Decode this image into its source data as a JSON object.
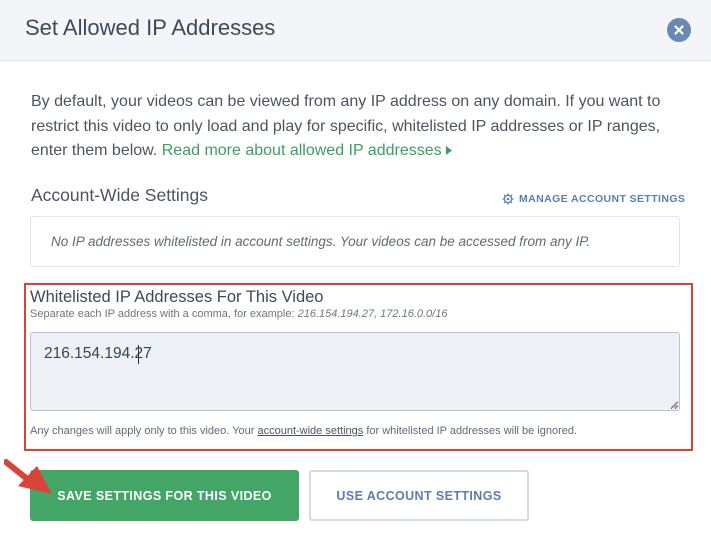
{
  "dialog": {
    "title": "Set Allowed IP Addresses",
    "close_icon": "close-icon"
  },
  "intro": {
    "text": "By default, your videos can be viewed from any IP address on any domain. If you want to restrict this video to only load and play for specific, whitelisted IP addresses or IP ranges, enter them below.",
    "link_text": "Read more about allowed IP addresses",
    "link_icon": "caret-right-icon"
  },
  "account_settings": {
    "heading": "Account-Wide Settings",
    "manage_label": "MANAGE ACCOUNT SETTINGS",
    "manage_icon": "gear-icon",
    "note": "No IP addresses whitelisted in account settings. Your videos can be accessed from any IP."
  },
  "whitelist": {
    "label": "Whitelisted IP Addresses For This Video",
    "help_prefix": "Separate each IP address with a comma, for example: ",
    "help_example": "216.154.194.27, 172.16.0.0/16",
    "value": "216.154.194.27",
    "note_prefix": "Any changes will apply only to this video. Your ",
    "note_link": "account-wide settings",
    "note_suffix": " for whitelisted IP addresses will be ignored."
  },
  "buttons": {
    "save": "SAVE SETTINGS FOR THIS VIDEO",
    "use_account": "USE ACCOUNT SETTINGS"
  },
  "annotation": {
    "highlight_color": "#d9443a",
    "arrow_icon": "pointer-arrow-icon"
  },
  "colors": {
    "accent_green": "#43a667",
    "link_green": "#3d9e62",
    "link_blue": "#5a7fae"
  }
}
